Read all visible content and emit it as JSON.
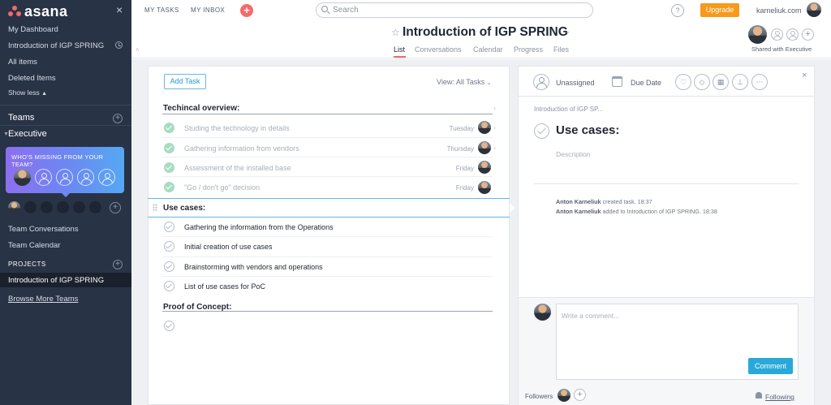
{
  "sidebar": {
    "logo": "asana",
    "close": "×",
    "links": [
      "My Dashboard",
      "Introduction of IGP SPRING",
      "All items",
      "Deleted Items"
    ],
    "show_less": "Show less",
    "teams_label": "Teams",
    "team_name": "Executive",
    "missing_title": "WHO'S MISSING FROM YOUR TEAM?",
    "team_conversations": "Team Conversations",
    "team_calendar": "Team Calendar",
    "projects_label": "PROJECTS",
    "active_project": "Introduction of IGP SPRING",
    "browse_more": "Browse More Teams"
  },
  "topbar": {
    "my_tasks": "MY TASKS",
    "my_inbox": "MY INBOX",
    "quick_add": "+",
    "search_placeholder": "Search",
    "help": "?",
    "upgrade": "Upgrade",
    "domain": "karneliuk.com"
  },
  "project": {
    "title": "Introduction of IGP SPRING",
    "tabs": [
      "List",
      "Conversations",
      "Calendar",
      "Progress",
      "Files"
    ],
    "active_tab": "List",
    "shared": "Shared with Executive"
  },
  "list": {
    "add_task": "Add Task",
    "view": "View: All Tasks",
    "sections": [
      {
        "name": "Techincal overview:",
        "tasks": [
          {
            "name": "Studing the technology in details",
            "due": "Tuesday",
            "done": true
          },
          {
            "name": "Gathering information from vendors",
            "due": "Thursday",
            "done": true
          },
          {
            "name": "Assessment of the installed base",
            "due": "Friday",
            "done": true
          },
          {
            "name": "\"Go / don't go\" decision",
            "due": "Friday",
            "done": true
          }
        ]
      },
      {
        "name": "Use cases:",
        "tasks": [
          {
            "name": "Gathering the information from the Operations",
            "done": false
          },
          {
            "name": "Initial creation of use cases",
            "done": false
          },
          {
            "name": "Brainstorming with vendors and operations",
            "done": false
          },
          {
            "name": "List of use cases for PoC",
            "done": false
          }
        ]
      },
      {
        "name": "Proof of Concept:",
        "tasks": [
          {
            "name": "",
            "done": false
          }
        ]
      }
    ]
  },
  "detail": {
    "assignee": "Unassigned",
    "due_date": "Due Date",
    "breadcrumb": "Introduction of IGP SP...",
    "title": "Use cases:",
    "description_placeholder": "Description",
    "stories": [
      {
        "author": "Anton Karneliuk",
        "action": "created task.",
        "time": "18:37"
      },
      {
        "author": "Anton Karneliuk",
        "action": "added to Introduction of IGP SPRING.",
        "time": "18:38"
      }
    ],
    "comment_placeholder": "Write a comment...",
    "comment_button": "Comment",
    "followers_label": "Followers",
    "following": "Following",
    "close": "×"
  },
  "colors": {
    "sidebar_bg": "#283346",
    "accent_coral": "#f86a6a",
    "upgrade_orange": "#f79a1b",
    "comment_blue": "#29a9d9",
    "done_green": "#a8dcc3"
  }
}
